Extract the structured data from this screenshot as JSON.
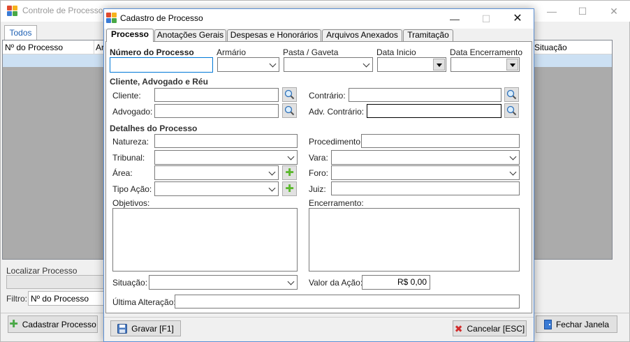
{
  "background_window": {
    "title": "Controle de Processos",
    "controls": {
      "minimize": "—",
      "maximize": "☐",
      "close": "✕"
    },
    "tab": "Todos",
    "grid_columns": [
      "Nº do Processo",
      "Ar",
      "Situação"
    ],
    "locate_label": "Localizar Processo",
    "filter_label": "Filtro:",
    "filter_value": "Nº do Processo",
    "btn_cadastrar": "Cadastrar Processo",
    "btn_fechar": "Fechar Janela"
  },
  "dialog": {
    "title": "Cadastro de Processo",
    "controls": {
      "minimize": "—",
      "maximize": "☐",
      "close": "✕"
    },
    "tabs": [
      "Processo",
      "Anotações Gerais",
      "Despesas e Honorários",
      "Arquivos Anexados",
      "Tramitação"
    ],
    "fields": {
      "numero_label": "Número do Processo",
      "numero_value": "",
      "armario_label": "Armário",
      "pasta_label": "Pasta / Gaveta",
      "data_inicio_label": "Data Inicio",
      "data_encerramento_label": "Data Encerramento"
    },
    "section_cliente": "Cliente, Advogado e Réu",
    "cliente_label": "Cliente:",
    "contrario_label": "Contrário:",
    "advogado_label": "Advogado:",
    "adv_contrario_label": "Adv. Contrário:",
    "section_detalhes": "Detalhes do Processo",
    "natureza_label": "Natureza:",
    "procedimento_label": "Procedimento:",
    "tribunal_label": "Tribunal:",
    "vara_label": "Vara:",
    "area_label": "Área:",
    "foro_label": "Foro:",
    "tipo_acao_label": "Tipo Ação:",
    "juiz_label": "Juiz:",
    "objetivos_label": "Objetivos:",
    "encerramento_label": "Encerramento:",
    "situacao_label": "Situação:",
    "valor_acao_label": "Valor da Ação:",
    "valor_acao_value": "R$ 0,00",
    "ultima_alteracao_label": "Última Alteração:",
    "btn_gravar": "Gravar [F1]",
    "btn_cancelar": "Cancelar [ESC]"
  },
  "colors": {
    "accent": "#0078d7",
    "selection": "#cce0f3",
    "tab_text": "#1d5fb3"
  }
}
